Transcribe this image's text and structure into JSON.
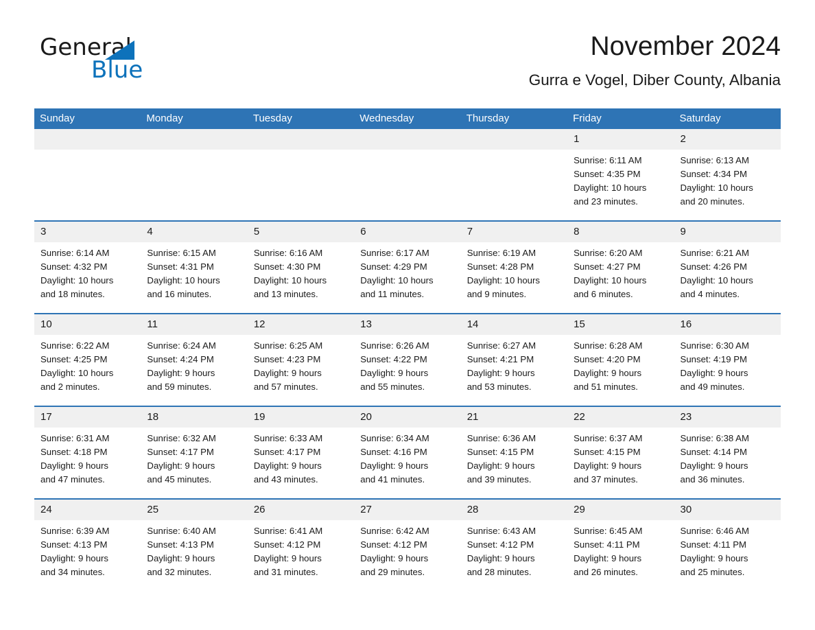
{
  "brand": {
    "logo_word1": "General",
    "logo_word2": "Blue",
    "logo_triangle_color": "#0d72bb"
  },
  "header": {
    "title": "November 2024",
    "subtitle": "Gurra e Vogel, Diber County, Albania"
  },
  "theme": {
    "header_blue": "#2e74b5",
    "daynum_gray": "#f0f0f0",
    "text": "#1a1a1a"
  },
  "calendar": {
    "weekday_headers": [
      "Sunday",
      "Monday",
      "Tuesday",
      "Wednesday",
      "Thursday",
      "Friday",
      "Saturday"
    ],
    "weeks": [
      [
        {
          "day": "",
          "detail": ""
        },
        {
          "day": "",
          "detail": ""
        },
        {
          "day": "",
          "detail": ""
        },
        {
          "day": "",
          "detail": ""
        },
        {
          "day": "",
          "detail": ""
        },
        {
          "day": "1",
          "detail": "Sunrise: 6:11 AM\nSunset: 4:35 PM\nDaylight: 10 hours\nand 23 minutes."
        },
        {
          "day": "2",
          "detail": "Sunrise: 6:13 AM\nSunset: 4:34 PM\nDaylight: 10 hours\nand 20 minutes."
        }
      ],
      [
        {
          "day": "3",
          "detail": "Sunrise: 6:14 AM\nSunset: 4:32 PM\nDaylight: 10 hours\nand 18 minutes."
        },
        {
          "day": "4",
          "detail": "Sunrise: 6:15 AM\nSunset: 4:31 PM\nDaylight: 10 hours\nand 16 minutes."
        },
        {
          "day": "5",
          "detail": "Sunrise: 6:16 AM\nSunset: 4:30 PM\nDaylight: 10 hours\nand 13 minutes."
        },
        {
          "day": "6",
          "detail": "Sunrise: 6:17 AM\nSunset: 4:29 PM\nDaylight: 10 hours\nand 11 minutes."
        },
        {
          "day": "7",
          "detail": "Sunrise: 6:19 AM\nSunset: 4:28 PM\nDaylight: 10 hours\nand 9 minutes."
        },
        {
          "day": "8",
          "detail": "Sunrise: 6:20 AM\nSunset: 4:27 PM\nDaylight: 10 hours\nand 6 minutes."
        },
        {
          "day": "9",
          "detail": "Sunrise: 6:21 AM\nSunset: 4:26 PM\nDaylight: 10 hours\nand 4 minutes."
        }
      ],
      [
        {
          "day": "10",
          "detail": "Sunrise: 6:22 AM\nSunset: 4:25 PM\nDaylight: 10 hours\nand 2 minutes."
        },
        {
          "day": "11",
          "detail": "Sunrise: 6:24 AM\nSunset: 4:24 PM\nDaylight: 9 hours\nand 59 minutes."
        },
        {
          "day": "12",
          "detail": "Sunrise: 6:25 AM\nSunset: 4:23 PM\nDaylight: 9 hours\nand 57 minutes."
        },
        {
          "day": "13",
          "detail": "Sunrise: 6:26 AM\nSunset: 4:22 PM\nDaylight: 9 hours\nand 55 minutes."
        },
        {
          "day": "14",
          "detail": "Sunrise: 6:27 AM\nSunset: 4:21 PM\nDaylight: 9 hours\nand 53 minutes."
        },
        {
          "day": "15",
          "detail": "Sunrise: 6:28 AM\nSunset: 4:20 PM\nDaylight: 9 hours\nand 51 minutes."
        },
        {
          "day": "16",
          "detail": "Sunrise: 6:30 AM\nSunset: 4:19 PM\nDaylight: 9 hours\nand 49 minutes."
        }
      ],
      [
        {
          "day": "17",
          "detail": "Sunrise: 6:31 AM\nSunset: 4:18 PM\nDaylight: 9 hours\nand 47 minutes."
        },
        {
          "day": "18",
          "detail": "Sunrise: 6:32 AM\nSunset: 4:17 PM\nDaylight: 9 hours\nand 45 minutes."
        },
        {
          "day": "19",
          "detail": "Sunrise: 6:33 AM\nSunset: 4:17 PM\nDaylight: 9 hours\nand 43 minutes."
        },
        {
          "day": "20",
          "detail": "Sunrise: 6:34 AM\nSunset: 4:16 PM\nDaylight: 9 hours\nand 41 minutes."
        },
        {
          "day": "21",
          "detail": "Sunrise: 6:36 AM\nSunset: 4:15 PM\nDaylight: 9 hours\nand 39 minutes."
        },
        {
          "day": "22",
          "detail": "Sunrise: 6:37 AM\nSunset: 4:15 PM\nDaylight: 9 hours\nand 37 minutes."
        },
        {
          "day": "23",
          "detail": "Sunrise: 6:38 AM\nSunset: 4:14 PM\nDaylight: 9 hours\nand 36 minutes."
        }
      ],
      [
        {
          "day": "24",
          "detail": "Sunrise: 6:39 AM\nSunset: 4:13 PM\nDaylight: 9 hours\nand 34 minutes."
        },
        {
          "day": "25",
          "detail": "Sunrise: 6:40 AM\nSunset: 4:13 PM\nDaylight: 9 hours\nand 32 minutes."
        },
        {
          "day": "26",
          "detail": "Sunrise: 6:41 AM\nSunset: 4:12 PM\nDaylight: 9 hours\nand 31 minutes."
        },
        {
          "day": "27",
          "detail": "Sunrise: 6:42 AM\nSunset: 4:12 PM\nDaylight: 9 hours\nand 29 minutes."
        },
        {
          "day": "28",
          "detail": "Sunrise: 6:43 AM\nSunset: 4:12 PM\nDaylight: 9 hours\nand 28 minutes."
        },
        {
          "day": "29",
          "detail": "Sunrise: 6:45 AM\nSunset: 4:11 PM\nDaylight: 9 hours\nand 26 minutes."
        },
        {
          "day": "30",
          "detail": "Sunrise: 6:46 AM\nSunset: 4:11 PM\nDaylight: 9 hours\nand 25 minutes."
        }
      ]
    ]
  }
}
